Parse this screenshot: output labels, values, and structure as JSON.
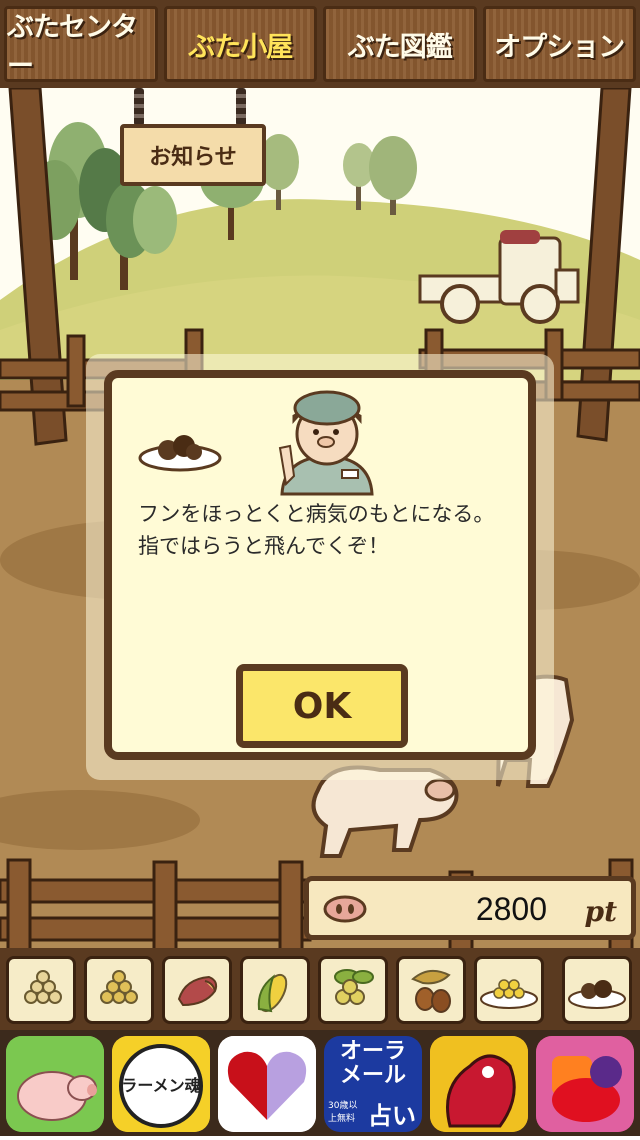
{
  "nav": {
    "items": [
      {
        "label": "ぶたセンター",
        "active": false
      },
      {
        "label": "ぶた小屋",
        "active": true
      },
      {
        "label": "ぶた図鑑",
        "active": false
      },
      {
        "label": "オプション",
        "active": false
      }
    ]
  },
  "notice": {
    "label": "お知らせ"
  },
  "dialog": {
    "message": "フンをほっとくと病気のもとになる。\n指ではらうと飛んでくぞ！",
    "ok_label": "OK"
  },
  "points": {
    "value": "2800",
    "unit": "pt"
  },
  "feeds": [
    {
      "icon": "soybeans-icon"
    },
    {
      "icon": "beans-icon"
    },
    {
      "icon": "sweet-potato-icon"
    },
    {
      "icon": "corn-icon"
    },
    {
      "icon": "edamame-icon"
    },
    {
      "icon": "acorn-icon"
    },
    {
      "icon": "bean-plate-icon"
    },
    {
      "icon": "truffle-plate-icon"
    }
  ],
  "ads": {
    "ad2_text": "ラーメン魂",
    "ad4_line1": "オーラ",
    "ad4_line2": "メール",
    "ad4_line3": "占い",
    "ad4_badge": "30歳以上無料"
  },
  "colors": {
    "wood": "#5a3a20",
    "dialog_bg": "#fffbd6",
    "ok_bg": "#fbe66a",
    "nav_active": "#ffe45a"
  }
}
